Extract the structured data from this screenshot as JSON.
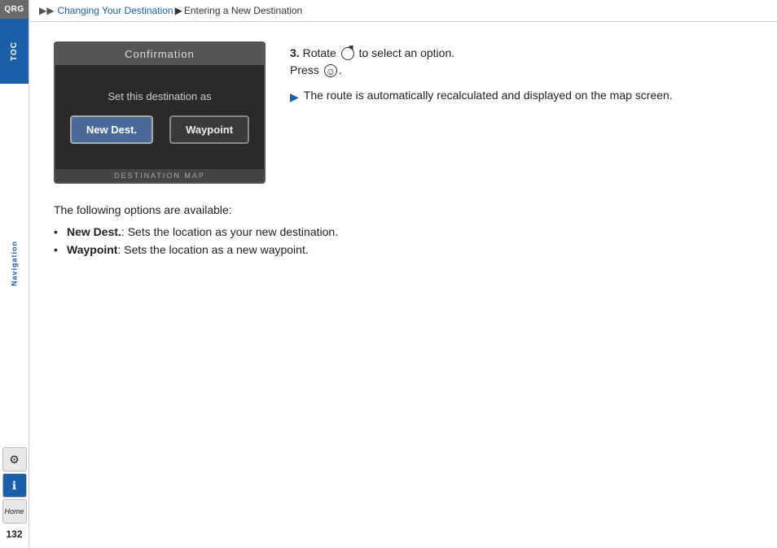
{
  "sidebar": {
    "qrg_label": "QRG",
    "toc_label": "TOC",
    "nav_label": "Navigation",
    "page_number": "132",
    "icons": {
      "settings": "⚙",
      "info": "ℹ",
      "home": "Home"
    }
  },
  "breadcrumb": {
    "arrows": "▶▶",
    "part1": "Changing Your Destination",
    "separator1": "▶",
    "part2": "Entering a New Destination"
  },
  "confirmation_screen": {
    "title": "Confirmation",
    "subtitle": "Set this destination as",
    "button1": "New Dest.",
    "button2": "Waypoint",
    "footer": "DESTINATION MAP"
  },
  "step": {
    "number": "3.",
    "main_text": "Rotate  to select an option. Press .",
    "rotate_label": "Rotate",
    "press_label": "Press",
    "result_prefix": "▶",
    "result_text": "The route is automatically recalculated and displayed on the map screen."
  },
  "options": {
    "intro": "The following options are available:",
    "items": [
      {
        "bold": "New Dest.",
        "text": ": Sets the location as your new destination."
      },
      {
        "bold": "Waypoint",
        "text": ": Sets the location as a new waypoint."
      }
    ]
  }
}
